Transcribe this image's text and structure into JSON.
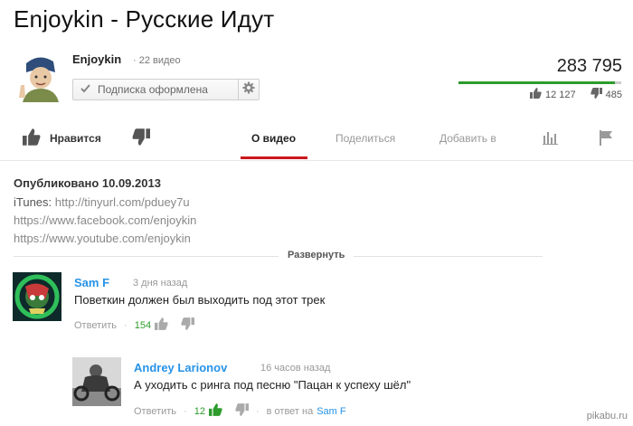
{
  "video": {
    "title": "Enjoykin - Русские Идут",
    "views": "283 795",
    "like_ratio": 0.962,
    "likes": "12 127",
    "dislikes": "485"
  },
  "channel": {
    "name": "Enjoykin",
    "video_count": "· 22 видео",
    "subscribe_label": "Подписка оформлена"
  },
  "actions": {
    "like_label": "Нравится",
    "tabs": [
      {
        "label": "О видео"
      },
      {
        "label": "Поделиться"
      },
      {
        "label": "Добавить в"
      }
    ]
  },
  "description": {
    "published": "Опубликовано 10.09.2013",
    "itunes_label": "iTunes:",
    "itunes_url": "http://tinyurl.com/pduey7u",
    "facebook_url": "https://www.facebook.com/enjoykin",
    "youtube_url": "https://www.youtube.com/enjoykin",
    "expand_label": "Развернуть"
  },
  "comments": [
    {
      "author": "Sam F",
      "time": "3 дня назад",
      "text": "Поветкин должен был выходить под этот трек",
      "reply_label": "Ответить",
      "likes": "154"
    },
    {
      "author": "Andrey Larionov",
      "time": "16 часов назад",
      "text": "А уходить с ринга под песню \"Пацан к успеху шёл\"",
      "reply_label": "Ответить",
      "likes": "12",
      "reply_to_prefix": "в ответ на",
      "reply_to": "Sam F"
    }
  ],
  "watermark": "pikabu.ru",
  "colors": {
    "accent_red": "#cc181e",
    "like_green": "#2d9c2d",
    "link_blue": "#2793e6"
  }
}
